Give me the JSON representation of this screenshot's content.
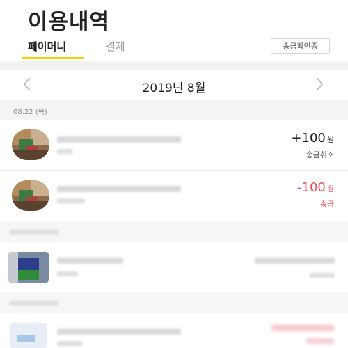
{
  "header": {
    "title": "이용내역"
  },
  "tabs": [
    {
      "label": "페이머니",
      "active": true
    },
    {
      "label": "결제",
      "active": false
    }
  ],
  "toolbar": {
    "confirm_label": "송금확인증"
  },
  "month_nav": {
    "label": "2019년 8월",
    "prev_icon": "chevron-left-icon",
    "next_icon": "chevron-right-icon"
  },
  "date_header": {
    "label": "08.22 (목)"
  },
  "transactions": [
    {
      "amount": "+100",
      "currency": "원",
      "status": "송금취소",
      "color": "#222222"
    },
    {
      "amount": "-100",
      "currency": "원",
      "status": "송금",
      "color": "#e8525f"
    }
  ],
  "colors": {
    "accent_yellow": "#f5d100",
    "negative_red": "#e8525f"
  }
}
